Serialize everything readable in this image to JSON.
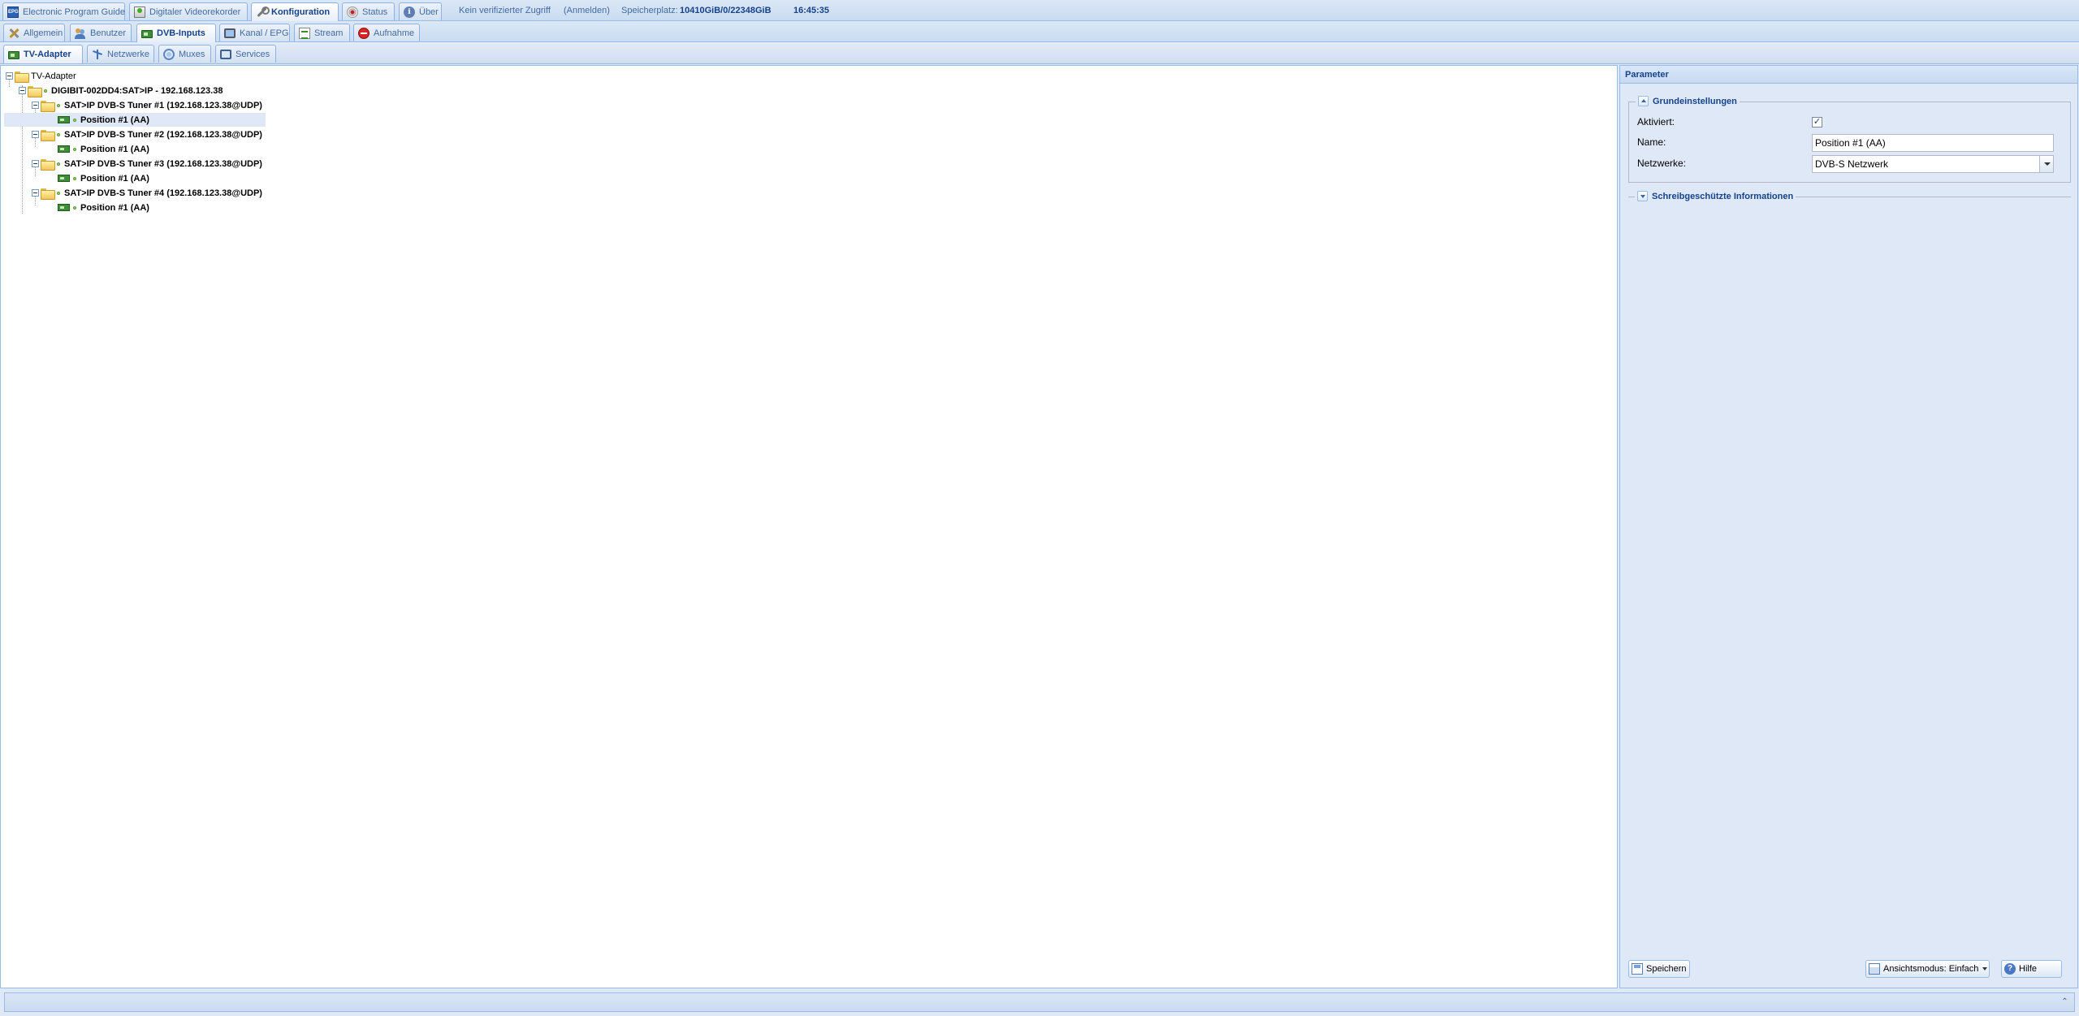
{
  "main_tabs": [
    {
      "label": "Electronic Program Guide",
      "icon": "epg-icon"
    },
    {
      "label": "Digitaler Videorekorder",
      "icon": "dvr-icon"
    },
    {
      "label": "Konfiguration",
      "icon": "wrench-icon",
      "active": true
    },
    {
      "label": "Status",
      "icon": "status-icon"
    },
    {
      "label": "Über",
      "icon": "info-icon"
    }
  ],
  "header_info": {
    "access": "Kein verifizierter Zugriff",
    "login": "(Anmelden)",
    "storage_label": "Speicherplatz:",
    "storage_value": "10410GiB/0/22348GiB",
    "time": "16:45:35"
  },
  "config_tabs": [
    {
      "label": "Allgemein",
      "icon": "tools-icon"
    },
    {
      "label": "Benutzer",
      "icon": "users-icon"
    },
    {
      "label": "DVB-Inputs",
      "icon": "tv-card-icon",
      "active": true
    },
    {
      "label": "Kanal / EPG",
      "icon": "tv-icon"
    },
    {
      "label": "Stream",
      "icon": "stream-icon"
    },
    {
      "label": "Aufnahme",
      "icon": "record-icon"
    }
  ],
  "dvb_tabs": [
    {
      "label": "TV-Adapter",
      "icon": "tv-card-icon",
      "active": true
    },
    {
      "label": "Netzwerke",
      "icon": "network-icon"
    },
    {
      "label": "Muxes",
      "icon": "mux-icon"
    },
    {
      "label": "Services",
      "icon": "services-icon"
    }
  ],
  "tree": {
    "root": "TV-Adapter",
    "device": "DIGIBIT-002DD4:SAT>IP - 192.168.123.38",
    "tuners": [
      {
        "label": "SAT>IP DVB-S Tuner #1 (192.168.123.38@UDP)",
        "position": "Position #1 (AA)",
        "selected": true
      },
      {
        "label": "SAT>IP DVB-S Tuner #2 (192.168.123.38@UDP)",
        "position": "Position #1 (AA)"
      },
      {
        "label": "SAT>IP DVB-S Tuner #3 (192.168.123.38@UDP)",
        "position": "Position #1 (AA)"
      },
      {
        "label": "SAT>IP DVB-S Tuner #4 (192.168.123.38@UDP)",
        "position": "Position #1 (AA)"
      }
    ]
  },
  "params": {
    "title": "Parameter",
    "basic_section": "Grundeinstellungen",
    "readonly_section": "Schreibgeschützte Informationen",
    "enabled_label": "Aktiviert:",
    "enabled_checked": true,
    "name_label": "Name:",
    "name_value": "Position #1 (AA)",
    "networks_label": "Netzwerke:",
    "networks_value": "DVB-S Netzwerk",
    "check_glyph": "✓"
  },
  "buttons": {
    "save": "Speichern",
    "view_mode": "Ansichtsmodus: Einfach",
    "help": "Hilfe"
  }
}
